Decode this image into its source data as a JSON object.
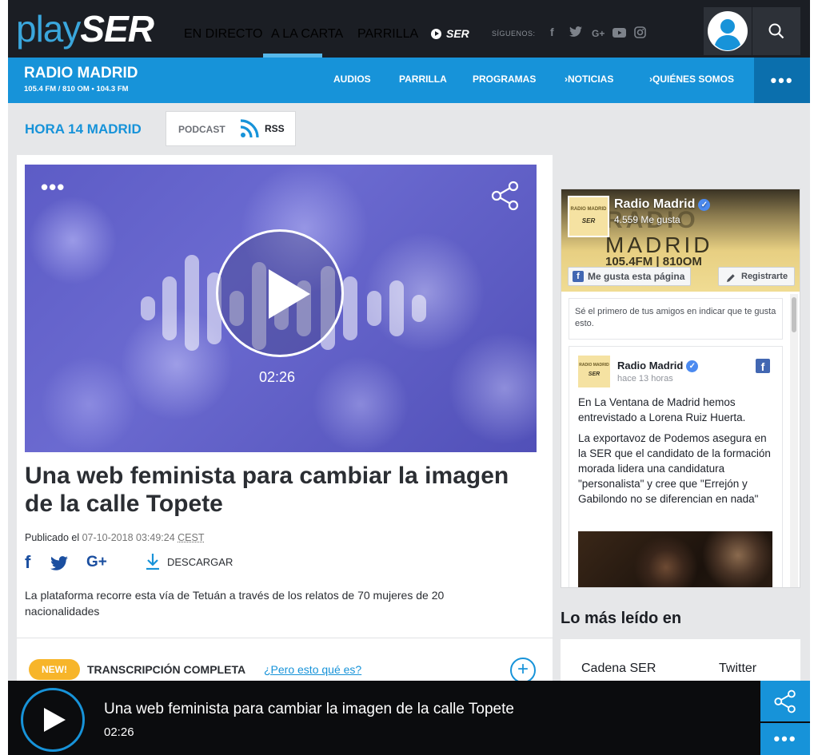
{
  "topnav": {
    "logo_play": "play",
    "logo_ser": "SER",
    "items": [
      "EN DIRECTO",
      "A LA CARTA",
      "PARRILLA"
    ],
    "ser_link": "SER",
    "siguenos": "SÍGUENOS:",
    "social": [
      "f",
      "twitter",
      "G+",
      "youtube",
      "instagram"
    ],
    "accent_color": "#57b8ea"
  },
  "station": {
    "name": "RADIO MADRID",
    "freq": "105.4 FM / 810 OM • 104.3 FM",
    "nav": [
      "AUDIOS",
      "PARRILLA",
      "PROGRAMAS",
      "NOTICIAS",
      "QUIÉNES SOMOS"
    ],
    "color": "#1793d9"
  },
  "program": {
    "title": "HORA 14 MADRID",
    "podcast_label": "PODCAST",
    "rss_label": "RSS"
  },
  "player": {
    "duration": "02:26"
  },
  "article": {
    "headline": "Una web feminista para cambiar la imagen de la calle Topete",
    "published_label": "Publicado el",
    "published_date": "07-10-2018 03:49:24",
    "timezone": "CEST",
    "download_label": "DESCARGAR",
    "summary": "La plataforma recorre esta vía de Tetuán a través de los relatos de 70 mujeres de 20 nacionalidades",
    "new_badge": "NEW!",
    "transcription_label": "TRANSCRIPCIÓN COMPLETA",
    "transcription_link": "¿Pero esto qué es?"
  },
  "facebook": {
    "cover_text_1": "RADIO",
    "cover_text_2": "MADRID",
    "cover_text_3": "105.4FM | 810OM",
    "thumb_line1": "RADIO MADRID",
    "thumb_line2": "SER",
    "page_name": "Radio Madrid",
    "likes": "4.559 Me gusta",
    "like_button": "Me gusta esta página",
    "register_button": "Registrarte",
    "friends_text": "Sé el primero de tus amigos en indicar que te gusta esto.",
    "post_author": "Radio Madrid",
    "post_time": "hace 13 horas",
    "post_p1": "En La Ventana de Madrid hemos entrevistado a Lorena Ruiz Huerta.",
    "post_p2": "La exportavoz de Podemos asegura en la SER que el candidato de la formación morada lidera una candidatura \"personalista\" y cree que \"Errejón y Gabilondo no se diferencian en nada\""
  },
  "mas_leido": {
    "title": "Lo más leído en",
    "tabs": [
      "Cadena SER",
      "Twitter"
    ]
  },
  "bottom_player": {
    "title": "Una web feminista para cambiar la imagen de la calle Topete",
    "time": "02:26"
  }
}
